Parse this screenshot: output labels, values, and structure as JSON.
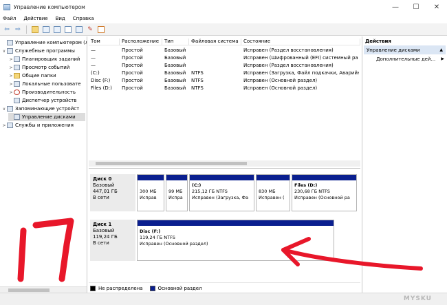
{
  "window": {
    "title": "Управление компьютером",
    "controls": [
      "—",
      "☐",
      "✕"
    ]
  },
  "menu": [
    "Файл",
    "Действие",
    "Вид",
    "Справка"
  ],
  "toolbar": {
    "icons": [
      "back-arrow-icon",
      "forward-arrow-icon",
      "up-folder-icon",
      "console-tree-icon",
      "properties-icon",
      "help-icon",
      "connect-icon",
      "settings-icon",
      "check-icon"
    ]
  },
  "tree": {
    "items": [
      {
        "label": "Управление компьютером (л",
        "level": 0,
        "expander": ""
      },
      {
        "label": "Служебные программы",
        "level": 1,
        "expander": "∨"
      },
      {
        "label": "Планировщик заданий",
        "level": 2,
        "expander": ">"
      },
      {
        "label": "Просмотр событий",
        "level": 2,
        "expander": ">"
      },
      {
        "label": "Общие папки",
        "level": 2,
        "expander": ">"
      },
      {
        "label": "Локальные пользовате",
        "level": 2,
        "expander": ">"
      },
      {
        "label": "Производительность",
        "level": 2,
        "expander": ">"
      },
      {
        "label": "Диспетчер устройств",
        "level": 2,
        "expander": ""
      },
      {
        "label": "Запоминающие устройст",
        "level": 1,
        "expander": "∨"
      },
      {
        "label": "Управление дисками",
        "level": 2,
        "expander": "",
        "selected": true
      },
      {
        "label": "Службы и приложения",
        "level": 1,
        "expander": ">"
      }
    ]
  },
  "volumes": {
    "columns": [
      "Том",
      "Расположение",
      "Тип",
      "Файловая система",
      "Состояние"
    ],
    "rows": [
      [
        "—",
        "Простой",
        "Базовый",
        "",
        "Исправен (Раздел восстановления)"
      ],
      [
        "—",
        "Простой",
        "Базовый",
        "",
        "Исправен (Шифрованный (EFI) системный ра"
      ],
      [
        "—",
        "Простой",
        "Базовый",
        "",
        "Исправен (Раздел восстановления)"
      ],
      [
        "(C:)",
        "Простой",
        "Базовый",
        "NTFS",
        "Исправен (Загрузка, Файл подкачки, Аварийн"
      ],
      [
        "Disc (F:)",
        "Простой",
        "Базовый",
        "NTFS",
        "Исправен (Основной раздел)"
      ],
      [
        "Files (D:)",
        "Простой",
        "Базовый",
        "NTFS",
        "Исправен (Основной раздел)"
      ]
    ]
  },
  "disks": [
    {
      "name": "Диск 0",
      "type": "Базовый",
      "size": "447,01 ГБ",
      "status": "В сети",
      "partitions": [
        {
          "title": "",
          "size": "300 МБ",
          "status": "Исправ"
        },
        {
          "title": "",
          "size": "99 МБ",
          "status": "Испра"
        },
        {
          "title": "(C:)",
          "size": "215,12 ГБ NTFS",
          "status": "Исправен (Загрузка, Фа"
        },
        {
          "title": "",
          "size": "830 МБ",
          "status": "Исправен ("
        },
        {
          "title": "Files (D:)",
          "size": "230,68 ГБ NTFS",
          "status": "Исправен (Основной ра"
        }
      ]
    },
    {
      "name": "Диск 1",
      "type": "Базовый",
      "size": "119,24 ГБ",
      "status": "В сети",
      "partitions": [
        {
          "title": "Disc (F:)",
          "size": "119,24 ГБ NTFS",
          "status": "Исправен (Основной раздел)"
        }
      ]
    }
  ],
  "legend": [
    {
      "label": "Не распределена",
      "color": "#000000"
    },
    {
      "label": "Основной раздел",
      "color": "#0a1f8f"
    }
  ],
  "actions": {
    "header": "Действия",
    "section": "Управление дисками",
    "items": [
      "Дополнительные дей..."
    ]
  },
  "overlay": {
    "handwritten_number": "17",
    "color": "#e8172a"
  },
  "watermark": "MYSKU"
}
